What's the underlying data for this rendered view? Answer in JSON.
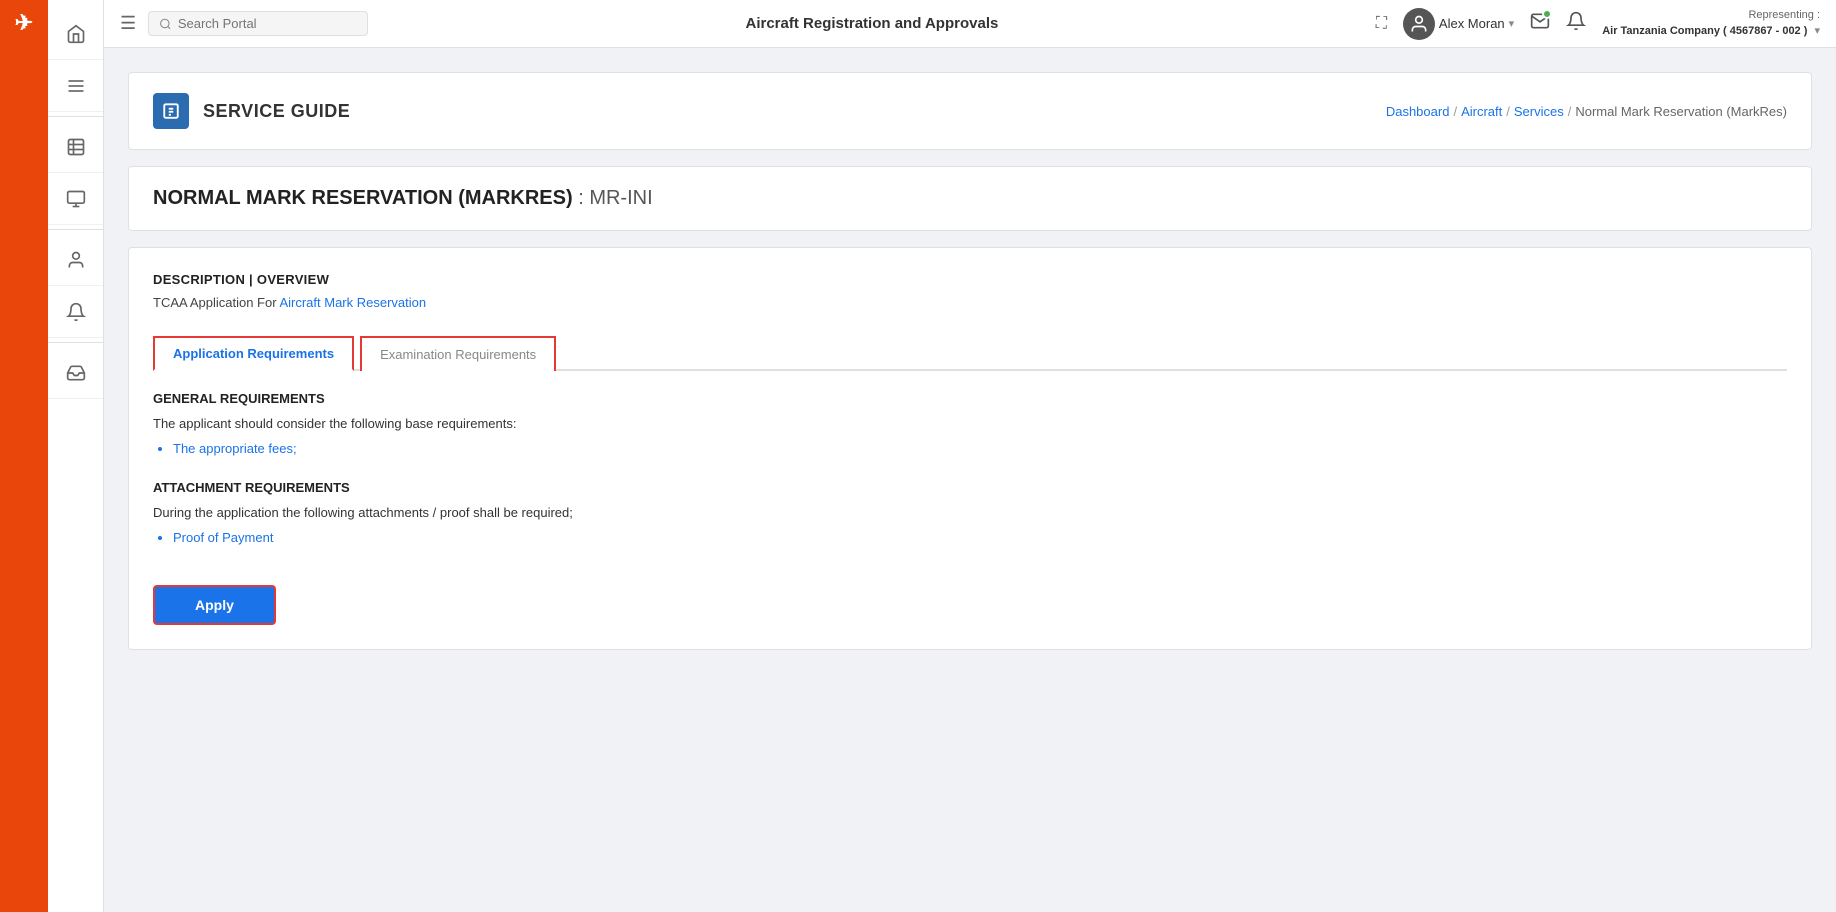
{
  "brand": {
    "logo_text": "✈"
  },
  "header": {
    "menu_icon": "☰",
    "search_placeholder": "Search Portal",
    "title": "Aircraft Registration and Approvals",
    "username": "Alex Moran",
    "representing_label": "Representing :",
    "representing_company": "Air Tanzania Company ( 4567867 - 002 )",
    "fullscreen_icon": "⛶"
  },
  "sidebar": {
    "items": [
      {
        "icon": "home",
        "label": "Home"
      },
      {
        "icon": "list",
        "label": "Menu"
      },
      {
        "icon": "document",
        "label": "Documents"
      },
      {
        "icon": "monitor",
        "label": "Monitor"
      },
      {
        "icon": "person",
        "label": "Person"
      },
      {
        "icon": "bell",
        "label": "Bell"
      },
      {
        "icon": "inbox",
        "label": "Inbox"
      }
    ]
  },
  "service_guide": {
    "icon_text": "S",
    "title": "SERVICE GUIDE"
  },
  "breadcrumb": {
    "items": [
      {
        "label": "Dashboard",
        "link": true
      },
      {
        "label": "Aircraft",
        "link": true
      },
      {
        "label": "Services",
        "link": true
      },
      {
        "label": "Normal Mark Reservation (MarkRes)",
        "link": false
      }
    ]
  },
  "page_title": {
    "main": "NORMAL MARK RESERVATION (MARKRES)",
    "code": ": MR-INI"
  },
  "description": {
    "section_title": "DESCRIPTION | OVERVIEW",
    "text_prefix": "TCAA Application For ",
    "link_text": "Aircraft Mark Reservation"
  },
  "tabs": [
    {
      "label": "Application Requirements",
      "active": true
    },
    {
      "label": "Examination Requirements",
      "active": false
    }
  ],
  "general_requirements": {
    "title": "GENERAL REQUIREMENTS",
    "description": "The applicant should consider the following base requirements:",
    "items": [
      "The appropriate fees;"
    ]
  },
  "attachment_requirements": {
    "title": "ATTACHMENT REQUIREMENTS",
    "description": "During the application the following attachments / proof shall be required;",
    "items": [
      "Proof of Payment"
    ]
  },
  "apply_button": {
    "label": "Apply"
  }
}
